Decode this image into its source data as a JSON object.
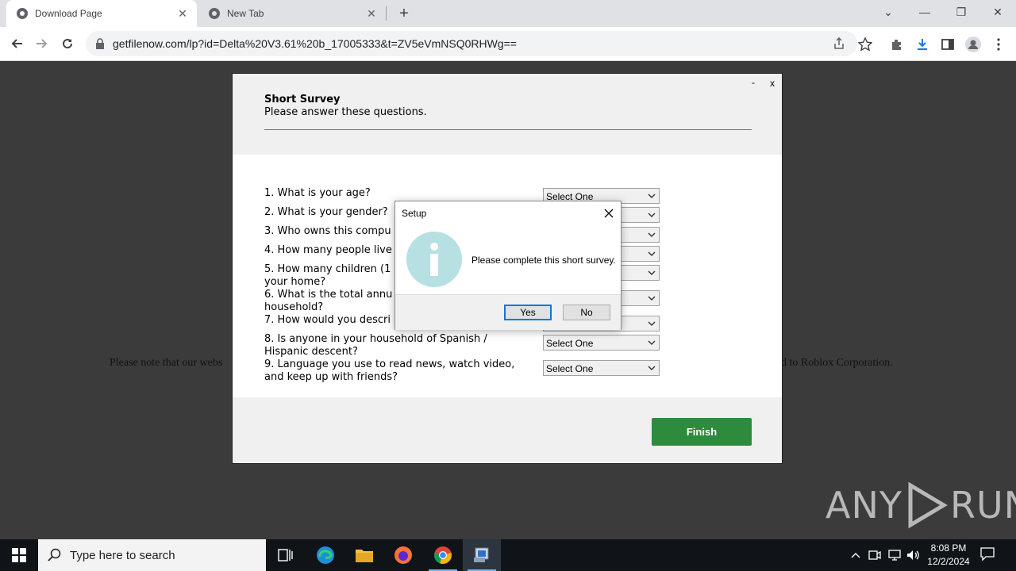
{
  "browser": {
    "tabs": [
      {
        "title": "Download Page",
        "active": true
      },
      {
        "title": "New Tab",
        "active": false
      }
    ],
    "url": "getfilenow.com/lp?id=Delta%20V3.61%20b_17005333&t=ZV5eVmNSQ0RHWg=="
  },
  "page": {
    "note_left": "Please note that our webs",
    "note_right": "d to Roblox Corporation."
  },
  "survey": {
    "minimize": "-",
    "close": "x",
    "title": "Short Survey",
    "subtitle": "Please answer these questions.",
    "questions": [
      {
        "text": "1. What is your age?",
        "value": "Select One"
      },
      {
        "text": "2. What is your gender?",
        "value": ""
      },
      {
        "text": "3. Who owns this compu",
        "value": ""
      },
      {
        "text": "4. How many people live",
        "value": ""
      },
      {
        "text": "5. How many children (1 your home?",
        "value": ""
      },
      {
        "text": "6. What is the total annu household?",
        "value": ""
      },
      {
        "text": "7. How would you descri",
        "value": ""
      },
      {
        "text": "8. Is anyone in your household of Spanish / Hispanic descent?",
        "value": "Select One"
      },
      {
        "text": "9. Language you use to read news, watch video, and keep up with friends?",
        "value": "Select One"
      }
    ],
    "finish_label": "Finish"
  },
  "dialog": {
    "title": "Setup",
    "message": "Please complete this short survey.",
    "yes_label": "Yes",
    "no_label": "No",
    "icon": "info-icon"
  },
  "watermark": {
    "text_left": "ANY",
    "text_right": "RUN"
  },
  "taskbar": {
    "search_placeholder": "Type here to search",
    "time": "8:08 PM",
    "date": "12/2/2024"
  },
  "colors": {
    "finish_button": "#2e8b3e",
    "page_background": "#3b3b3b",
    "info_icon": "#b7e0e3"
  }
}
